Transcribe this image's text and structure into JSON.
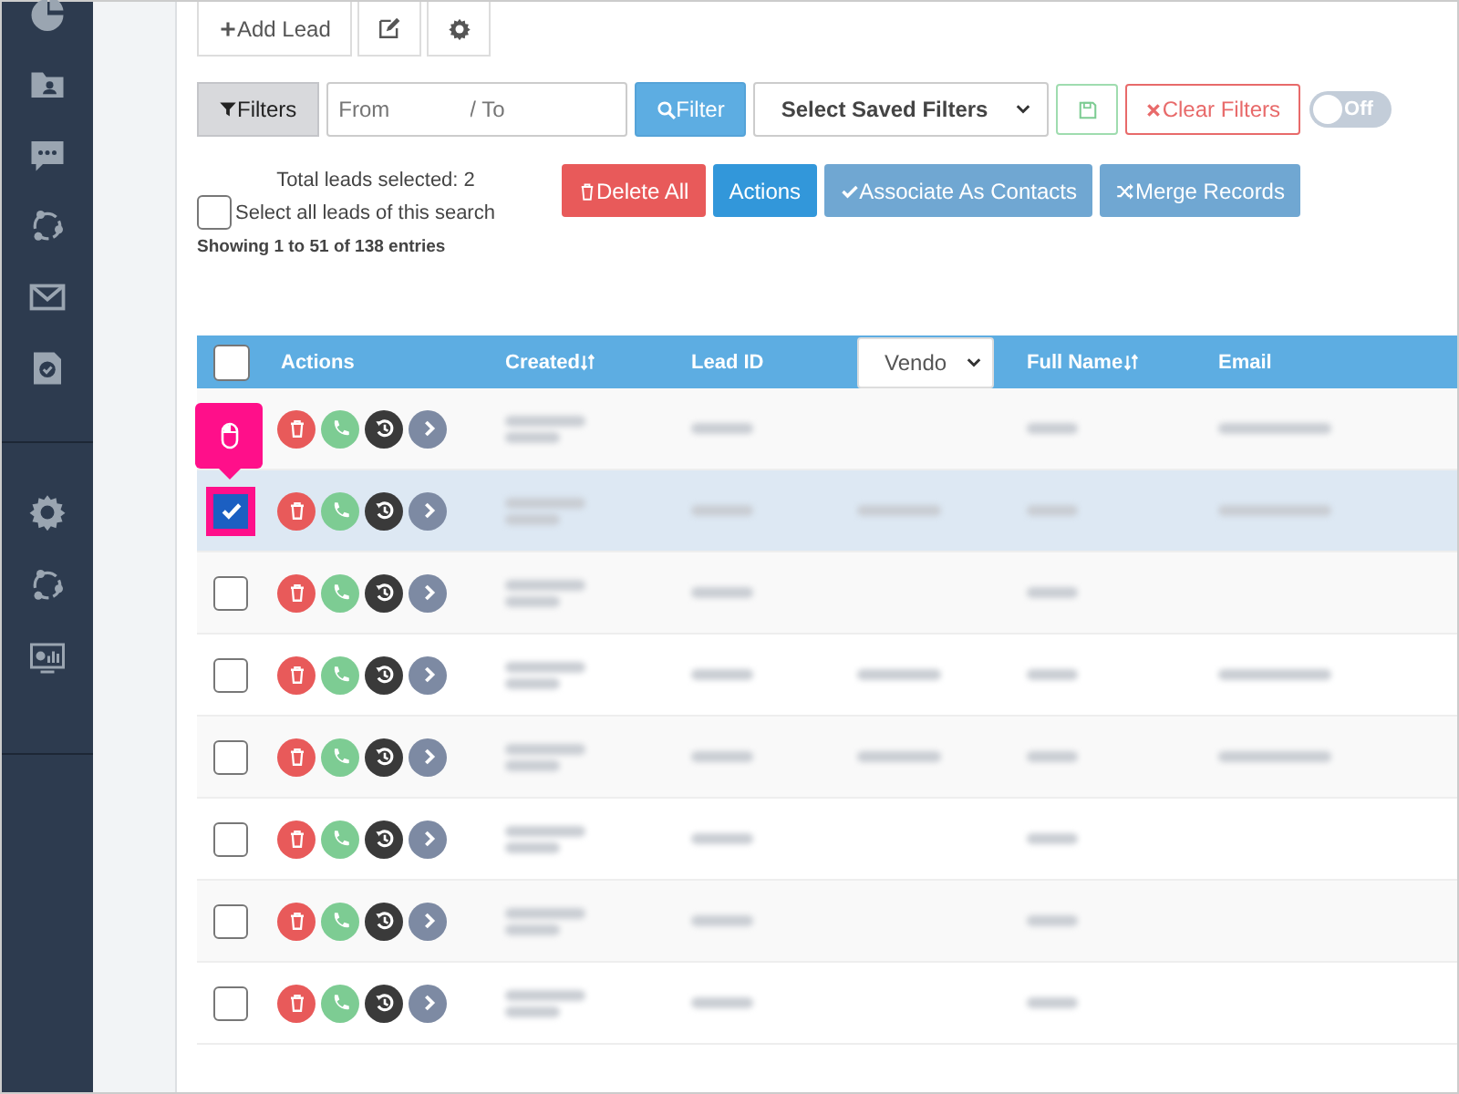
{
  "toolbar": {
    "add_lead": "Add Lead"
  },
  "filters": {
    "filters_button": "Filters",
    "from_placeholder": "From",
    "to_placeholder": "/ To",
    "filter_button": "Filter",
    "saved_filters": "Select Saved Filters",
    "clear_button": "Clear Filters",
    "toggle": {
      "label": "Off",
      "on": false
    }
  },
  "selection": {
    "total": "Total leads selected: 2",
    "select_all": {
      "label": "Select all leads of this search",
      "checked": false
    }
  },
  "bulk_actions": [
    {
      "label": "Delete All",
      "kind": "delete"
    },
    {
      "label": "Actions",
      "kind": "primary"
    },
    {
      "label": "Associate As Contacts",
      "kind": "associate"
    },
    {
      "label": "Merge Records",
      "kind": "merge"
    }
  ],
  "showing": "Showing 1 to 51 of 138 entries",
  "table": {
    "header_checked": false,
    "columns": [
      {
        "label": "Actions",
        "kind": "text"
      },
      {
        "label": "Created",
        "kind": "sort"
      },
      {
        "label": "Lead ID",
        "kind": "text"
      },
      {
        "label": "Vendo",
        "kind": "select"
      },
      {
        "label": "Full Name",
        "kind": "sort"
      },
      {
        "label": "Email",
        "kind": "text"
      }
    ],
    "rows": [
      {
        "tooltip": true,
        "selected": false,
        "blurred": [
          true,
          true,
          false,
          true,
          true
        ]
      },
      {
        "checked": true,
        "selected": true,
        "blurred": [
          true,
          true,
          true,
          true,
          true
        ]
      },
      {
        "checked": false,
        "selected": false,
        "blurred": [
          true,
          true,
          false,
          true,
          false
        ]
      },
      {
        "checked": false,
        "selected": false,
        "blurred": [
          true,
          true,
          true,
          true,
          true
        ]
      },
      {
        "checked": false,
        "selected": false,
        "blurred": [
          true,
          true,
          true,
          true,
          true
        ]
      },
      {
        "checked": false,
        "selected": false,
        "blurred": [
          true,
          true,
          false,
          true,
          false
        ]
      },
      {
        "checked": false,
        "selected": false,
        "blurred": [
          true,
          true,
          false,
          true,
          false
        ]
      },
      {
        "checked": false,
        "selected": false,
        "blurred": [
          true,
          true,
          false,
          true,
          false
        ]
      }
    ]
  }
}
